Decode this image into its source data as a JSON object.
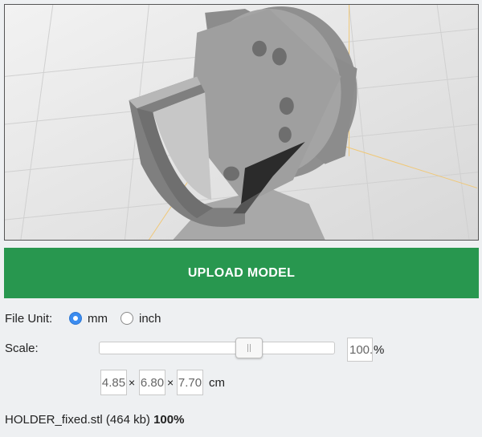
{
  "viewer": {
    "object": "3d-model-preview"
  },
  "upload_button": {
    "label": "UPLOAD MODEL",
    "color": "#28974f"
  },
  "file_unit": {
    "label": "File Unit:",
    "options": [
      {
        "label": "mm",
        "selected": true
      },
      {
        "label": "inch",
        "selected": false
      }
    ],
    "accent": "#3b8cf0"
  },
  "scale": {
    "label": "Scale:",
    "value": "100.",
    "suffix": "%",
    "slider_fraction": 0.65
  },
  "dimensions": {
    "x": "4.85",
    "y": "6.80",
    "z": "7.70",
    "sep": "×",
    "unit": "cm"
  },
  "status": {
    "filename": "HOLDER_fixed.stl",
    "size": "(464 kb)",
    "progress": "100%"
  }
}
